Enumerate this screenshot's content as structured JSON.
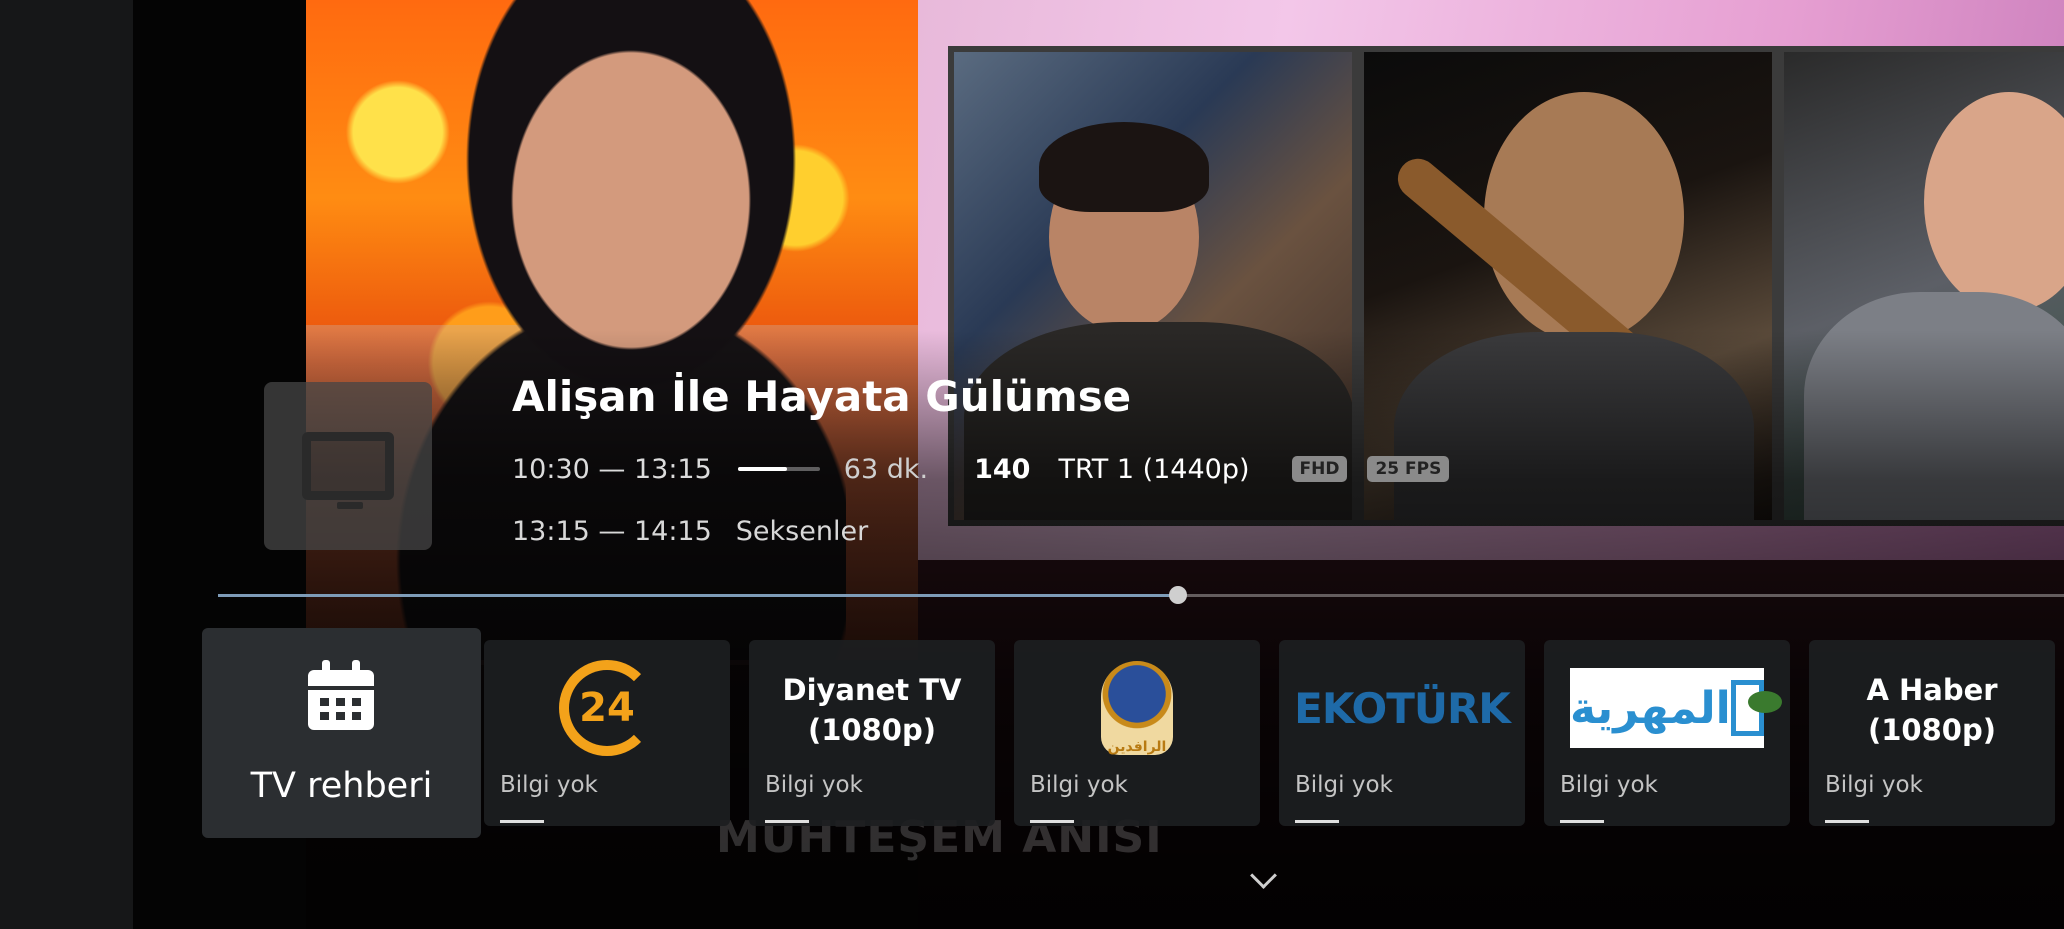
{
  "program": {
    "title": "Alişan İle Hayata Gülümse",
    "time_range": "10:30 — 13:15",
    "progress": 0.6,
    "duration": "63 dk.",
    "channel_number": "140",
    "channel_name": "TRT 1 (1440p)",
    "badges": [
      "FHD",
      "25 FPS"
    ],
    "next_time": "13:15 — 14:15",
    "next_title": "Seksenler"
  },
  "timeline": {
    "position": 0.52
  },
  "background_text": "MUHTEŞEM ANISI",
  "guide": {
    "label": "TV rehberi",
    "icon": "calendar-icon"
  },
  "channels": [
    {
      "logo_text": "24",
      "info": "Bilgi yok",
      "progress": 0.2
    },
    {
      "name_line1": "Diyanet TV",
      "name_line2": "(1080p)",
      "info": "Bilgi yok",
      "progress": 0.2
    },
    {
      "logo_text": "الرافدين",
      "info": "Bilgi yok",
      "progress": 0.2
    },
    {
      "logo_text": "EKOTÜRK",
      "info": "Bilgi yok",
      "progress": 0.2
    },
    {
      "logo_text": "المهرية",
      "info": "Bilgi yok",
      "progress": 0.2
    },
    {
      "name_line1": "A Haber",
      "name_line2": "(1080p)",
      "info": "Bilgi yok",
      "progress": 0.2
    }
  ],
  "colors": {
    "accent_timeline": "#7e9cb8",
    "card_bg": "#2b2e31"
  }
}
